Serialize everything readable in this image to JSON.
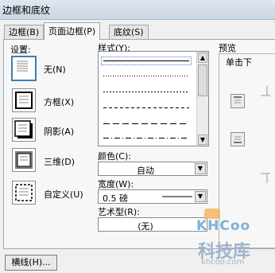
{
  "window": {
    "title": "边框和底纹"
  },
  "tabs": [
    {
      "label": "边框(B)"
    },
    {
      "label": "页面边框(P)"
    },
    {
      "label": "底纹(S)"
    }
  ],
  "settings": {
    "heading": "设置:",
    "options": [
      {
        "label": "无(N)",
        "icon": "border-none-icon"
      },
      {
        "label": "方框(X)",
        "icon": "border-box-icon"
      },
      {
        "label": "阴影(A)",
        "icon": "border-shadow-icon"
      },
      {
        "label": "三维(D)",
        "icon": "border-3d-icon"
      },
      {
        "label": "自定义(U)",
        "icon": "border-custom-icon"
      }
    ]
  },
  "style": {
    "heading": "样式(Y):"
  },
  "color": {
    "label": "颜色(C):",
    "value": "自动"
  },
  "width": {
    "label": "宽度(W):",
    "value": "0.5 磅"
  },
  "art": {
    "label": "艺术型(R):",
    "value": "(无)"
  },
  "preview": {
    "heading": "预览",
    "instruction": "单击下"
  },
  "footer": {
    "horizontal_line_label": "横线(H)..."
  },
  "watermark": {
    "logo": "KHCoo",
    "cn": "科技库",
    "url": "khcoo.com"
  },
  "colors": {
    "accent": "#3c7fb1",
    "selection": "#3a7bd5"
  }
}
